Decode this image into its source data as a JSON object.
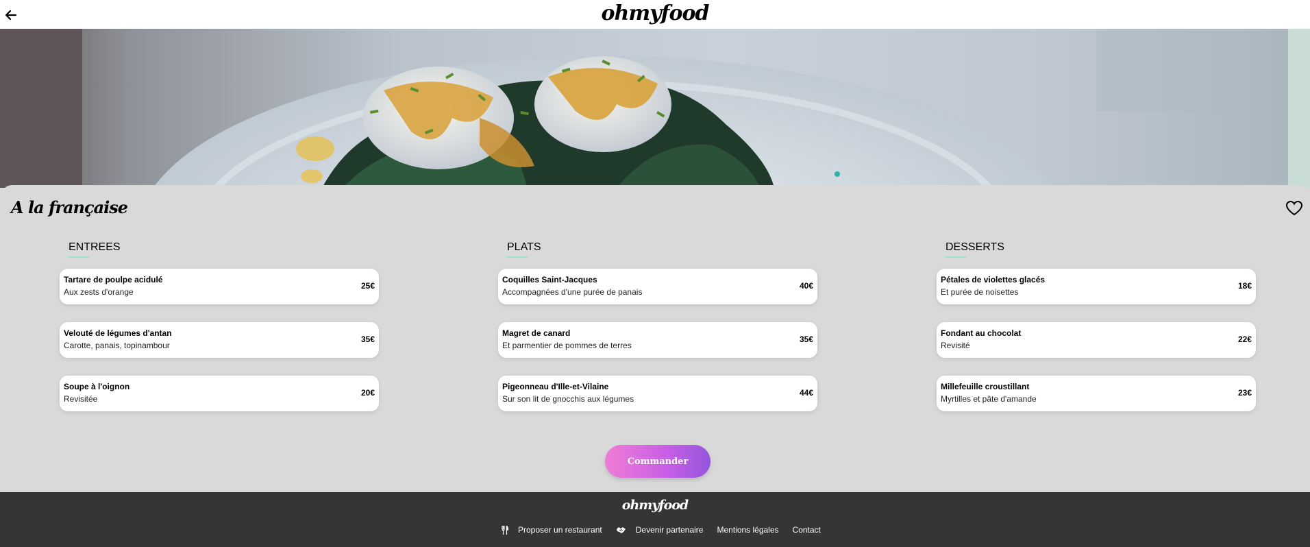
{
  "header": {
    "logo": "ohmyfood"
  },
  "restaurant": {
    "name": "A la française"
  },
  "menu": {
    "columns": [
      {
        "title": "ENTREES",
        "items": [
          {
            "name": "Tartare de poulpe acidulé",
            "desc": "Aux zests d'orange",
            "price": "25€"
          },
          {
            "name": "Velouté de légumes d'antan",
            "desc": "Carotte, panais, topinambour",
            "price": "35€"
          },
          {
            "name": "Soupe à l'oignon",
            "desc": "Revisitée",
            "price": "20€"
          }
        ]
      },
      {
        "title": "PLATS",
        "items": [
          {
            "name": "Coquilles Saint-Jacques",
            "desc": "Accompagnées d'une purée de panais",
            "price": "40€"
          },
          {
            "name": "Magret de canard",
            "desc": "Et parmentier de pommes de terres",
            "price": "35€"
          },
          {
            "name": "Pigeonneau d'Ille-et-Vilaine",
            "desc": "Sur son lit de gnocchis aux légumes",
            "price": "44€"
          }
        ]
      },
      {
        "title": "DESSERTS",
        "items": [
          {
            "name": "Pétales de violettes glacés",
            "desc": "Et purée de noisettes",
            "price": "18€"
          },
          {
            "name": "Fondant au chocolat",
            "desc": "Revisité",
            "price": "22€"
          },
          {
            "name": "Millefeuille croustillant",
            "desc": "Myrtilles et pâte d'amande",
            "price": "23€"
          }
        ]
      }
    ]
  },
  "order_button": {
    "label": "Commander"
  },
  "footer": {
    "logo": "ohmyfood",
    "links": [
      {
        "label": "Proposer un restaurant",
        "icon": "utensils-icon"
      },
      {
        "label": "Devenir partenaire",
        "icon": "handshake-icon"
      },
      {
        "label": "Mentions légales"
      },
      {
        "label": "Contact"
      }
    ]
  },
  "colors": {
    "accent_gradient_start": "#f07cd6",
    "accent_gradient_end": "#9356dc",
    "title_underline": "#99e2d0",
    "background": "#d9d9d9",
    "footer": "#353535"
  }
}
